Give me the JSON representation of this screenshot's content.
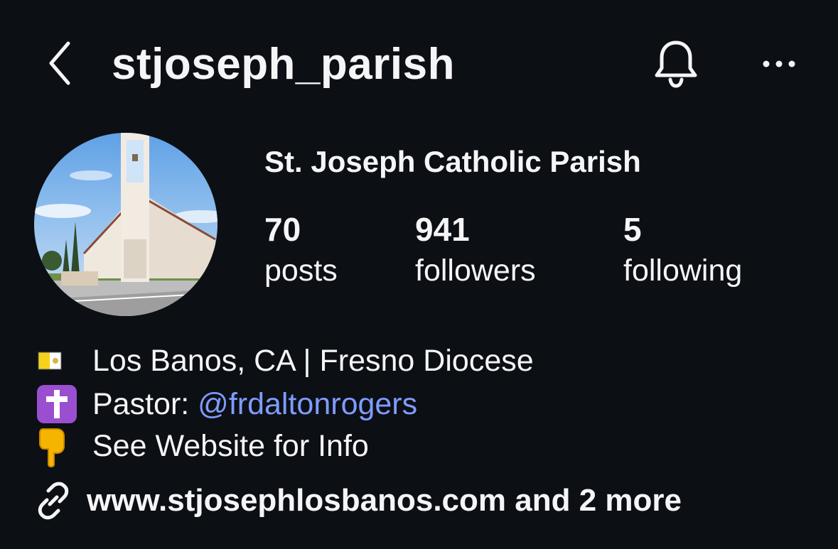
{
  "header": {
    "username": "stjoseph_parish",
    "back_icon": "chevron-left-icon",
    "bell_icon": "bell-icon",
    "more_icon": "more-horizontal-icon"
  },
  "profile": {
    "avatar_icon": "church-photo",
    "display_name": "St. Joseph Catholic Parish"
  },
  "stats": [
    {
      "value": "70",
      "label": "posts"
    },
    {
      "value": "941",
      "label": "followers"
    },
    {
      "value": "5",
      "label": "following"
    }
  ],
  "bio": {
    "line1": {
      "icon": "vatican-flag-icon",
      "text": "Los Banos, CA | Fresno Diocese"
    },
    "line2": {
      "icon": "cross-icon",
      "prefix": "Pastor: ",
      "mention": "@frdaltonrogers"
    },
    "line3": {
      "icon": "pointing-down-icon",
      "text": "See Website for Info"
    }
  },
  "link": {
    "icon": "link-icon",
    "text": "www.stjosephlosbanos.com and 2 more"
  },
  "colors": {
    "background": "#0c0f14",
    "text": "#f5f5f7",
    "mention": "#7f9cff"
  }
}
